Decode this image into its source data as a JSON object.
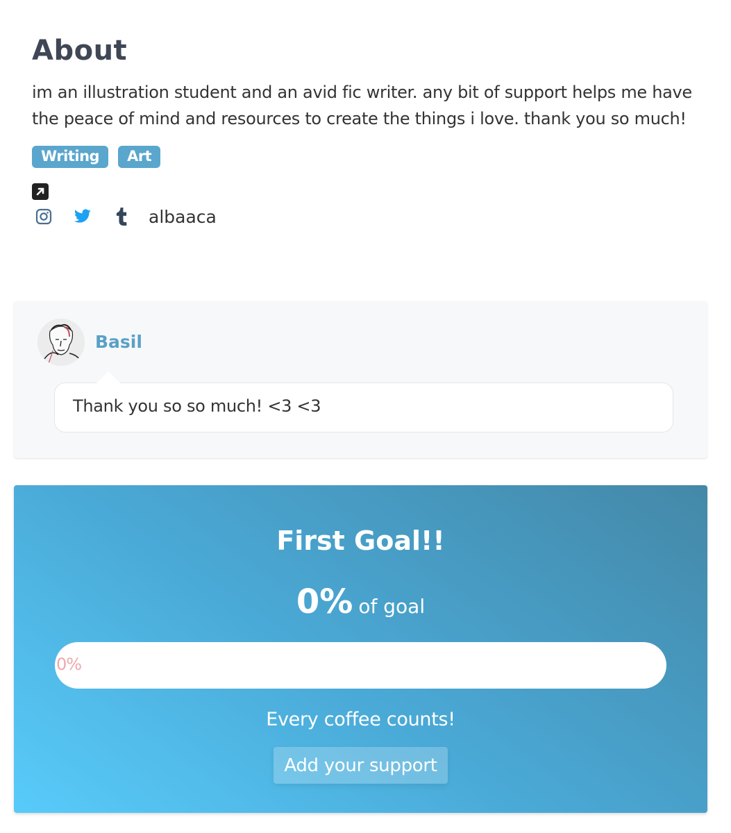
{
  "about": {
    "title": "About",
    "bio": "im an illustration student and an avid fic writer. any bit of support helps me have the peace of mind and resources to create the things i love. thank you so much!",
    "tags": [
      "Writing",
      "Art"
    ],
    "external_link_icon": "external-link-icon",
    "socials": [
      {
        "name": "instagram",
        "icon": "instagram-icon",
        "color": "#4a6e8f"
      },
      {
        "name": "twitter",
        "icon": "twitter-icon",
        "color": "#1da1f2"
      },
      {
        "name": "tumblr",
        "icon": "tumblr-icon",
        "color": "#35465c"
      }
    ],
    "handle": "albaaca"
  },
  "supporter": {
    "name": "Basil",
    "message": "Thank you so so much! <3 <3"
  },
  "goal": {
    "title": "First Goal!!",
    "percent_label": "0%",
    "of_goal_label": "of goal",
    "progress_percent": 0,
    "bar_label": "0%",
    "tagline": "Every coffee counts!",
    "button_label": "Add your support"
  },
  "colors": {
    "accent": "#5aa6cd",
    "gradient_start": "#58cbfa",
    "gradient_end": "#4488a8"
  }
}
